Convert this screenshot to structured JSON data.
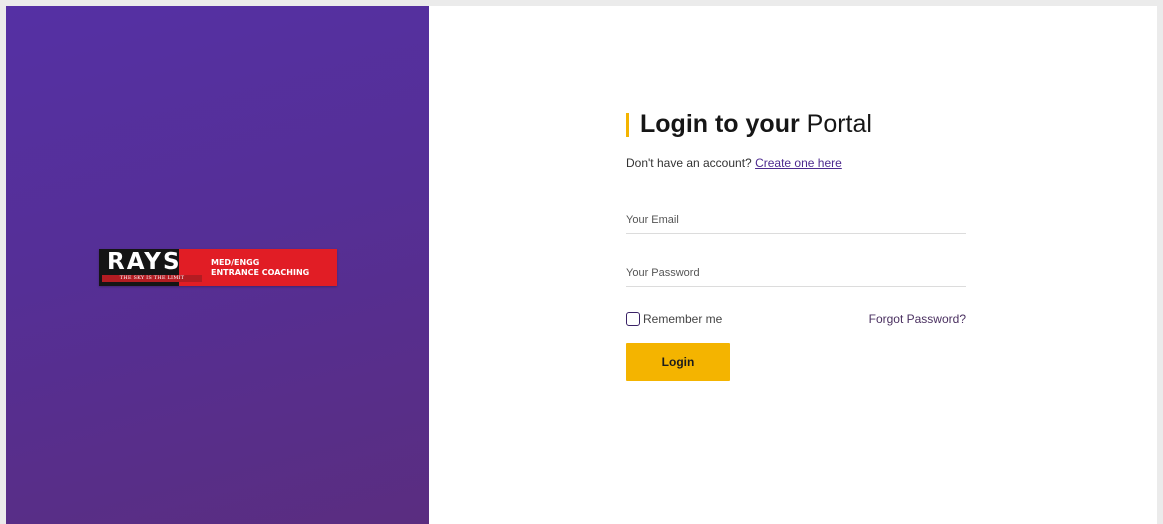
{
  "brand": {
    "logo_word": "RAYS",
    "logo_tagline": "THE SKY IS THE LIMIT",
    "logo_line1": "MED/ENGG",
    "logo_line2": "ENTRANCE COACHING"
  },
  "login": {
    "title_strong": "Login to your",
    "title_rest": "Portal",
    "signup_prompt": "Don't have an account?",
    "signup_link": "Create one here",
    "email_placeholder": "Your Email",
    "password_placeholder": "Your Password",
    "remember_label": "Remember me",
    "forgot_label": "Forgot Password?",
    "submit_label": "Login"
  },
  "colors": {
    "accent": "#f4b400",
    "brand_purple": "#5530a4",
    "logo_red": "#e11d25"
  }
}
